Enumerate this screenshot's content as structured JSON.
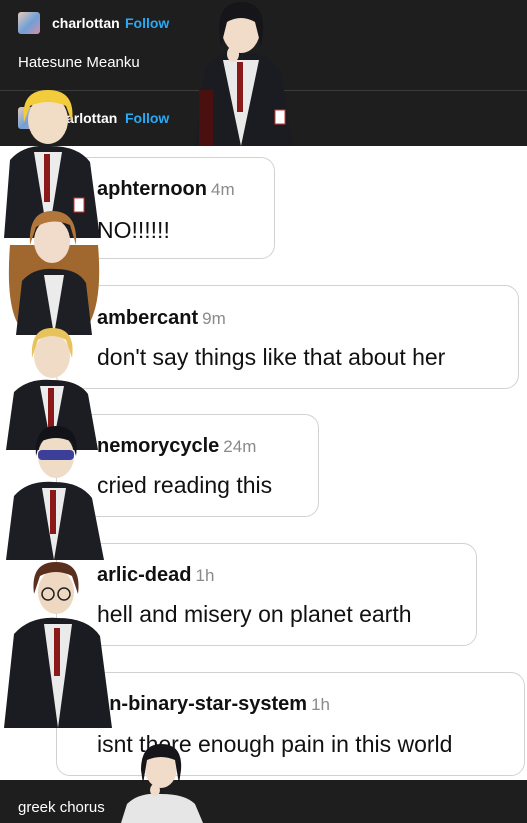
{
  "header_post": {
    "username": "charlottan",
    "follow_label": "Follow",
    "text": "Hatesune Meanku"
  },
  "reblog_post": {
    "username_partial": "arlottan",
    "follow_label": "Follow"
  },
  "comments": [
    {
      "user": "aphternoon",
      "time": "4m",
      "text": "NO!!!!!!"
    },
    {
      "user": "ambercant",
      "time": "9m",
      "text": "don't say things like that about her"
    },
    {
      "user": "nemorycycle",
      "time": "24m",
      "text": "cried reading this"
    },
    {
      "user": "arlic-dead",
      "time": "1h",
      "text": "hell and misery on planet earth"
    },
    {
      "user": "on-binary-star-system",
      "time": "1h",
      "text": "isnt there enough pain in this world"
    }
  ],
  "footer_post": {
    "text": "greek chorus"
  },
  "colors": {
    "dark_bg": "#1e1e1e",
    "follow_blue": "#2aa9f5",
    "bubble_border": "#d2d2d2"
  }
}
